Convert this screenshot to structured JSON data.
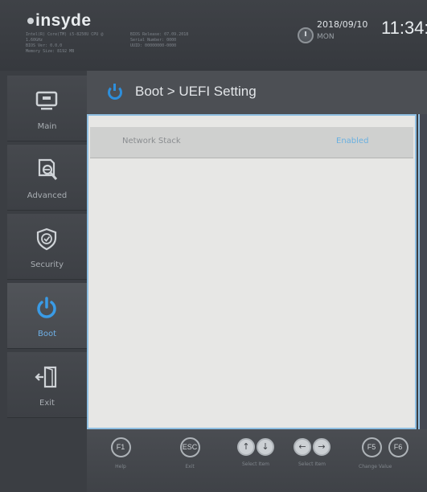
{
  "brand": {
    "logo": "insyde"
  },
  "system_info": {
    "left_lines": [
      "Intel(R) Core(TM) i5-8250U CPU @",
      "1.60GHz",
      "BIOS Ver: 0.0.0",
      "Memory Size: 8192 MB"
    ],
    "right_lines": [
      "BIOS Release: 07.09.2018",
      "Serial Number: 0000",
      "UUID: 00000000-0000"
    ]
  },
  "datetime": {
    "date": "2018/09/10",
    "day": "MON",
    "time": "11:34:"
  },
  "sidebar": {
    "items": [
      {
        "label": "Main",
        "icon": "monitor-icon"
      },
      {
        "label": "Advanced",
        "icon": "advanced-settings-icon"
      },
      {
        "label": "Security",
        "icon": "shield-icon"
      },
      {
        "label": "Boot",
        "icon": "power-icon"
      },
      {
        "label": "Exit",
        "icon": "exit-door-icon"
      }
    ],
    "active": "Boot"
  },
  "page": {
    "title": "Boot > UEFI Setting"
  },
  "settings": [
    {
      "name": "Network Stack",
      "value": "Enabled"
    }
  ],
  "footer": {
    "keys": [
      {
        "key": "F1",
        "caption": "Help"
      },
      {
        "key": "ESC",
        "caption": "Exit"
      },
      {
        "key": "F5",
        "caption": "Change Value"
      }
    ],
    "pairs": [
      {
        "keys": [
          "↑",
          "↓"
        ],
        "caption": "Select Item"
      },
      {
        "keys": [
          "←",
          "→"
        ],
        "caption": "Select Item"
      }
    ],
    "partial_key": "F6"
  },
  "colors": {
    "accent": "#2d8fdc",
    "panel_bg": "#e7e7e5",
    "panel_border": "#8fbfe2"
  }
}
